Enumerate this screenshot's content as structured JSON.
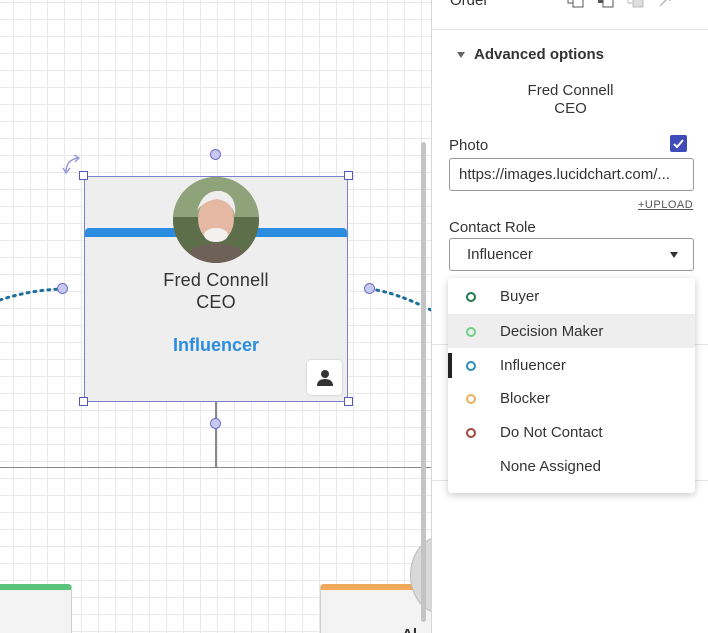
{
  "panel": {
    "order_label": "Order",
    "advanced_title": "Advanced options",
    "shape_name": "Fred Connell",
    "shape_title": "CEO",
    "photo_label": "Photo",
    "photo_url": "https://images.lucidchart.com/...",
    "upload_label": "+UPLOAD",
    "contact_role_label": "Contact Role",
    "contact_role_value": "Influencer",
    "role_options": [
      {
        "label": "Buyer",
        "color": "#1e7a4e"
      },
      {
        "label": "Decision Maker",
        "color": "#6fcf8b"
      },
      {
        "label": "Influencer",
        "color": "#2b8fb8"
      },
      {
        "label": "Blocker",
        "color": "#e8b25a"
      },
      {
        "label": "Do Not Contact",
        "color": "#a0493a"
      },
      {
        "label": "None Assigned",
        "color": ""
      }
    ]
  },
  "card": {
    "name": "Fred Connell",
    "title": "CEO",
    "role": "Influencer",
    "band_color": "#2b8de0"
  },
  "canvas": {
    "bottom_card_text": "Al"
  }
}
